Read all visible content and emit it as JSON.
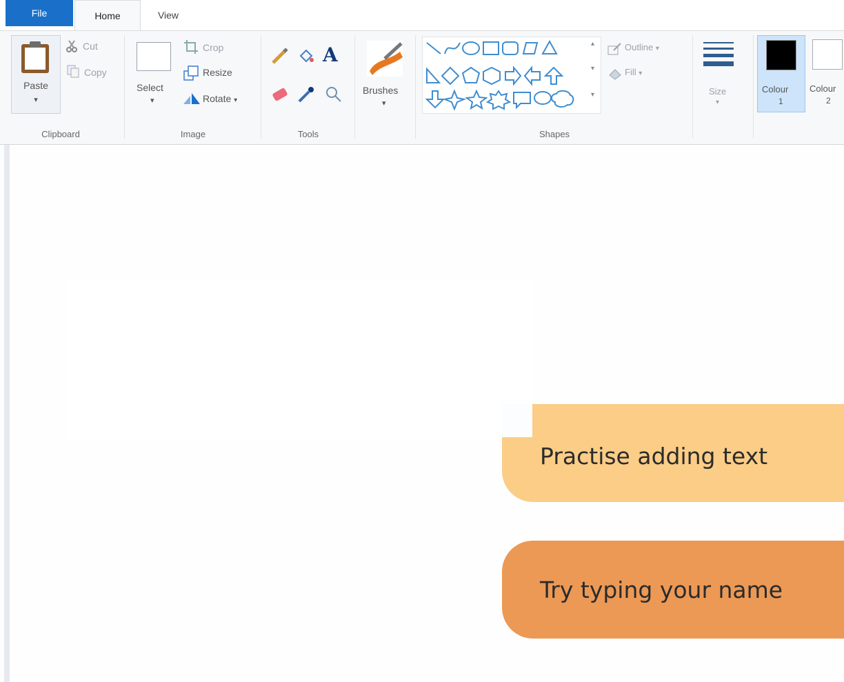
{
  "tabs": {
    "file": "File",
    "home": "Home",
    "view": "View"
  },
  "clipboard": {
    "paste": "Paste",
    "cut": "Cut",
    "copy": "Copy",
    "group": "Clipboard"
  },
  "image": {
    "select": "Select",
    "crop": "Crop",
    "resize": "Resize",
    "rotate": "Rotate",
    "group": "Image"
  },
  "tools": {
    "group": "Tools"
  },
  "brushes": {
    "label": "Brushes"
  },
  "shapes": {
    "outline": "Outline",
    "fill": "Fill",
    "group": "Shapes"
  },
  "size": {
    "label": "Size"
  },
  "colours": {
    "colour1_label": "Colour",
    "colour1_num": "1",
    "colour2_label": "Colour",
    "colour2_num": "2",
    "colour1_value": "#000000",
    "colour2_value": "#ffffff"
  },
  "banners": {
    "first": "Practise adding text",
    "second": "Try typing your name"
  },
  "colors": {
    "accent": "#1a6fc9",
    "banner1": "#fbcd86",
    "banner2": "#ec9956"
  }
}
